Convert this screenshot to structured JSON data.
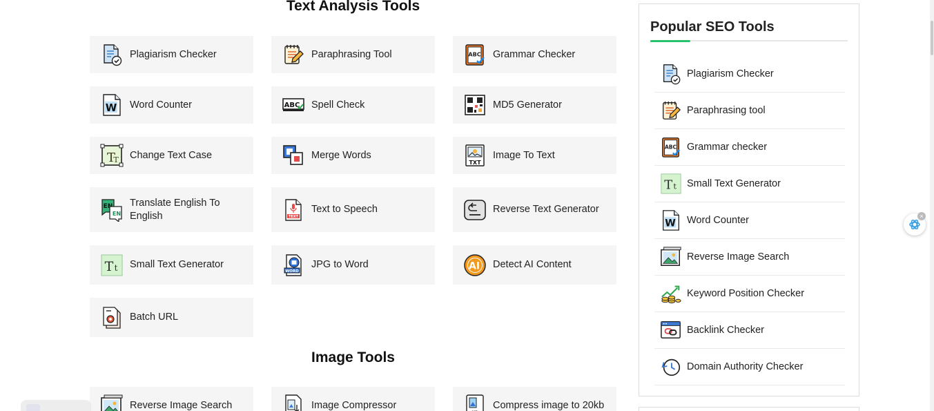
{
  "text_section": {
    "title": "Text Analysis Tools",
    "tools": [
      {
        "label": "Plagiarism Checker",
        "icon": "document-check-icon"
      },
      {
        "label": "Paraphrasing Tool",
        "icon": "notepad-pencil-icon"
      },
      {
        "label": "Grammar Checker",
        "icon": "abc-check-icon"
      },
      {
        "label": "Word Counter",
        "icon": "word-document-icon"
      },
      {
        "label": "Spell Check",
        "icon": "abc-spell-icon"
      },
      {
        "label": "MD5 Generator",
        "icon": "qr-code-icon"
      },
      {
        "label": "Change Text Case",
        "icon": "text-case-icon"
      },
      {
        "label": "Merge Words",
        "icon": "merge-squares-icon"
      },
      {
        "label": "Image To Text",
        "icon": "image-to-text-icon"
      },
      {
        "label": "Translate English To English",
        "icon": "translate-en-icon"
      },
      {
        "label": "Text to Speech",
        "icon": "text-speech-file-icon"
      },
      {
        "label": "Reverse Text Generator",
        "icon": "reverse-arrow-icon"
      },
      {
        "label": "Small Text Generator",
        "icon": "small-text-icon"
      },
      {
        "label": "JPG to Word",
        "icon": "jpg-word-icon"
      },
      {
        "label": "Detect AI Content",
        "icon": "ai-detect-icon"
      },
      {
        "label": "Batch URL",
        "icon": "batch-gear-icon"
      }
    ]
  },
  "image_section": {
    "title": "Image Tools",
    "tools": [
      {
        "label": "Reverse Image Search",
        "icon": "image-search-icon"
      },
      {
        "label": "Image Compressor",
        "icon": "image-compress-icon"
      },
      {
        "label": "Compress image to 20kb",
        "icon": "image-20kb-icon"
      }
    ]
  },
  "sidebar": {
    "title": "Popular SEO Tools",
    "accent_color": "#27c26c",
    "items": [
      {
        "label": "Plagiarism Checker",
        "icon": "document-check-icon"
      },
      {
        "label": "Paraphrasing tool",
        "icon": "notepad-pencil-icon"
      },
      {
        "label": "Grammar checker",
        "icon": "abc-check-icon"
      },
      {
        "label": "Small Text Generator",
        "icon": "small-text-icon"
      },
      {
        "label": "Word Counter",
        "icon": "word-document-icon"
      },
      {
        "label": "Reverse Image Search",
        "icon": "image-search-icon"
      },
      {
        "label": "Keyword Position Checker",
        "icon": "growth-chart-icon"
      },
      {
        "label": "Backlink Checker",
        "icon": "link-browser-icon"
      },
      {
        "label": "Domain Authority Checker",
        "icon": "history-clock-icon"
      }
    ]
  }
}
